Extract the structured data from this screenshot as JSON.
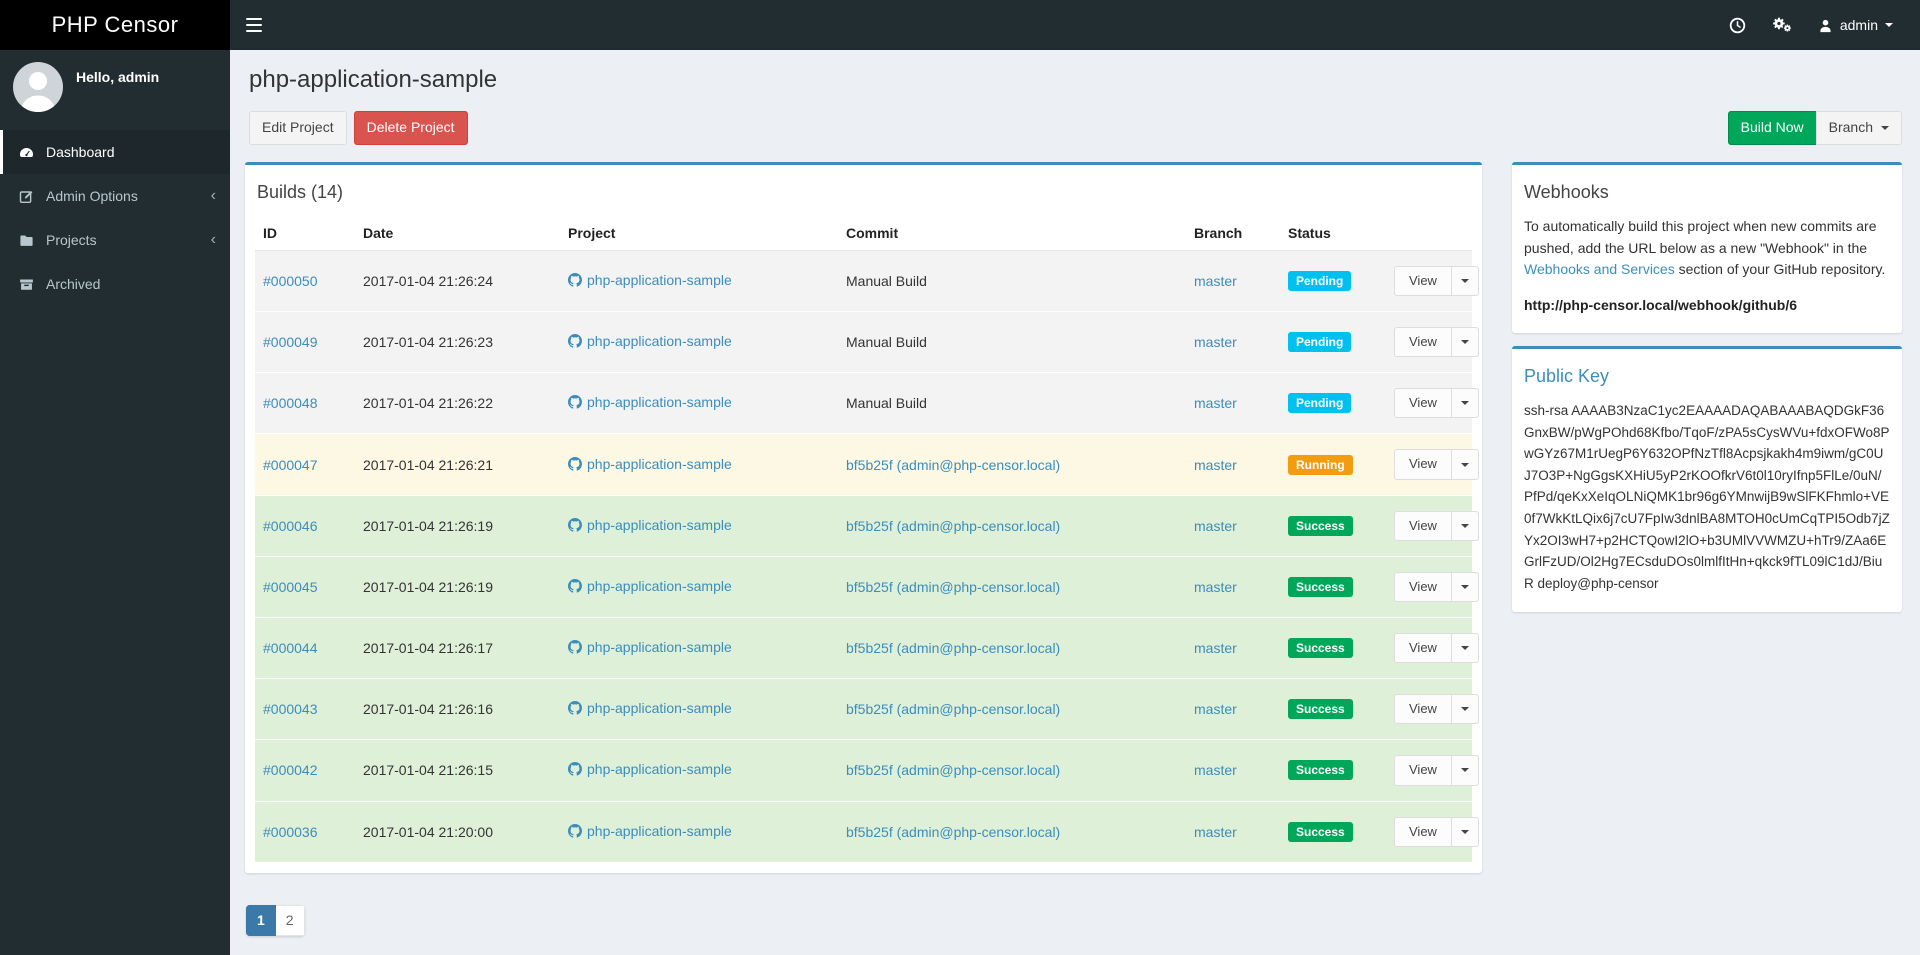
{
  "navbar": {
    "brand": "PHP Censor",
    "user": "admin"
  },
  "icons": {
    "chevron_left": "‹"
  },
  "sidebar": {
    "greeting": "Hello, admin",
    "items": [
      {
        "label": "Dashboard",
        "active": true,
        "has_submenu": false
      },
      {
        "label": "Admin Options",
        "active": false,
        "has_submenu": true
      },
      {
        "label": "Projects",
        "active": false,
        "has_submenu": true
      },
      {
        "label": "Archived",
        "active": false,
        "has_submenu": false
      }
    ]
  },
  "page": {
    "title": "php-application-sample",
    "edit_label": "Edit Project",
    "delete_label": "Delete Project",
    "build_now_label": "Build Now",
    "branch_label": "Branch"
  },
  "builds": {
    "title": "Builds (14)",
    "columns": [
      "ID",
      "Date",
      "Project",
      "Commit",
      "Branch",
      "Status"
    ],
    "view_label": "View",
    "rows": [
      {
        "id": "#000050",
        "date": "2017-01-04 21:26:24",
        "project": "php-application-sample",
        "commit": "Manual Build",
        "commit_is_link": false,
        "branch": "master",
        "status": "Pending",
        "row_style": "pending"
      },
      {
        "id": "#000049",
        "date": "2017-01-04 21:26:23",
        "project": "php-application-sample",
        "commit": "Manual Build",
        "commit_is_link": false,
        "branch": "master",
        "status": "Pending",
        "row_style": "pending"
      },
      {
        "id": "#000048",
        "date": "2017-01-04 21:26:22",
        "project": "php-application-sample",
        "commit": "Manual Build",
        "commit_is_link": false,
        "branch": "master",
        "status": "Pending",
        "row_style": "pending"
      },
      {
        "id": "#000047",
        "date": "2017-01-04 21:26:21",
        "project": "php-application-sample",
        "commit": "bf5b25f (admin@php-censor.local)",
        "commit_is_link": true,
        "branch": "master",
        "status": "Running",
        "row_style": "running"
      },
      {
        "id": "#000046",
        "date": "2017-01-04 21:26:19",
        "project": "php-application-sample",
        "commit": "bf5b25f (admin@php-censor.local)",
        "commit_is_link": true,
        "branch": "master",
        "status": "Success",
        "row_style": "success"
      },
      {
        "id": "#000045",
        "date": "2017-01-04 21:26:19",
        "project": "php-application-sample",
        "commit": "bf5b25f (admin@php-censor.local)",
        "commit_is_link": true,
        "branch": "master",
        "status": "Success",
        "row_style": "success"
      },
      {
        "id": "#000044",
        "date": "2017-01-04 21:26:17",
        "project": "php-application-sample",
        "commit": "bf5b25f (admin@php-censor.local)",
        "commit_is_link": true,
        "branch": "master",
        "status": "Success",
        "row_style": "success"
      },
      {
        "id": "#000043",
        "date": "2017-01-04 21:26:16",
        "project": "php-application-sample",
        "commit": "bf5b25f (admin@php-censor.local)",
        "commit_is_link": true,
        "branch": "master",
        "status": "Success",
        "row_style": "success"
      },
      {
        "id": "#000042",
        "date": "2017-01-04 21:26:15",
        "project": "php-application-sample",
        "commit": "bf5b25f (admin@php-censor.local)",
        "commit_is_link": true,
        "branch": "master",
        "status": "Success",
        "row_style": "success"
      },
      {
        "id": "#000036",
        "date": "2017-01-04 21:20:00",
        "project": "php-application-sample",
        "commit": "bf5b25f (admin@php-censor.local)",
        "commit_is_link": true,
        "branch": "master",
        "status": "Success",
        "row_style": "success"
      }
    ]
  },
  "pagination": {
    "pages": [
      "1",
      "2"
    ],
    "active_index": 0
  },
  "webhooks": {
    "title": "Webhooks",
    "text_before": "To automatically build this project when new commits are pushed, add the URL below as a new \"Webhook\" in the ",
    "link_text": "Webhooks and Services",
    "text_after": " section of your GitHub repository.",
    "url": "http://php-censor.local/webhook/github/6"
  },
  "public_key": {
    "title": "Public Key",
    "key": "ssh-rsa AAAAB3NzaC1yc2EAAAADAQABAAABAQDGkF36GnxBW/pWgPOhd68Kfbo/TqoF/zPA5sCysWVu+fdxOFWo8PwGYz67M1rUegP6Y632OPfNzTfl8Acpsjkakh4m9iwm/gC0UJ7O3P+NgGgsKXHiU5yP2rKOOfkrV6t0l10ryIfnp5FlLe/0uN/PfPd/qeKxXeIqOLNiQMK1br96g6YMnwijB9wSlFKFhmlo+VE0f7WkKtLQix6j7cU7FpIw3dnlBA8MTOH0cUmCqTPI5Odb7jZYx2OI3wH7+p2HCTQowI2lO+b3UMlVVWMZU+hTr9/ZAa6EGrlFzUD/Ol2Hg7ECsduDOs0lmlfItHn+qkck9fTL09lC1dJ/BiuR deploy@php-censor"
  }
}
